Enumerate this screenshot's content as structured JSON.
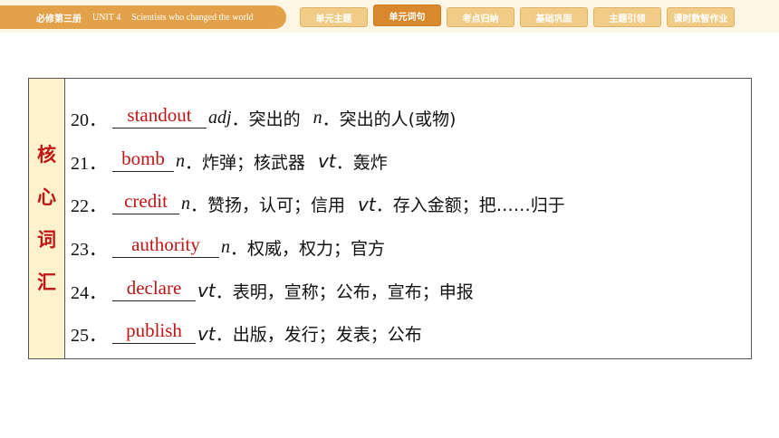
{
  "header": {
    "book": "必修第三册",
    "unit": "UNIT 4",
    "unit_title": "Scientists who changed the world",
    "tabs": [
      "单元主题",
      "单元词句",
      "考点归纳",
      "基础巩固",
      "主题引领",
      "课时数智作业"
    ],
    "active_tab": "单元词句"
  },
  "section_label": [
    "核",
    "心",
    "词",
    "汇"
  ],
  "rows": [
    {
      "num": "20．",
      "answer": "standout",
      "pos1": "adj",
      "meaning1": "突出的",
      "pos2": "n",
      "meaning2": "突出的人(或物)"
    },
    {
      "num": "21．",
      "answer": "bomb",
      "pos1": "n",
      "meaning1": "炸弹；核武器",
      "pos2": "vt",
      "meaning2": "轰炸"
    },
    {
      "num": "22．",
      "answer": "credit",
      "pos1": "n",
      "meaning1": "赞扬，认可；信用",
      "pos2": "vt",
      "meaning2": "存入金额；把……归于"
    },
    {
      "num": "23．",
      "answer": "authority",
      "pos1": "n",
      "meaning1": "权威，权力；官方"
    },
    {
      "num": "24．",
      "answer": "declare",
      "pos1": "vt",
      "meaning1": "表明，宣称；公布，宣布；申报"
    },
    {
      "num": "25．",
      "answer": "publish",
      "pos1": "vt",
      "meaning1": "出版，发行；发表；公布"
    }
  ],
  "colors": {
    "accent": "#e3a24a",
    "active_tab": "#d9892c",
    "tab": "#f0cc86",
    "answer_red": "#c01515",
    "label_bg": "#fdf2cc"
  }
}
